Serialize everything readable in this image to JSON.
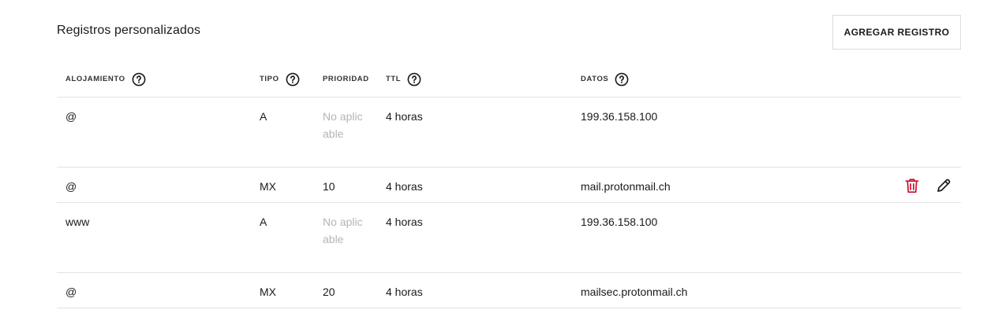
{
  "section": {
    "title": "Registros personalizados",
    "add_button_label": "AGREGAR REGISTRO"
  },
  "table": {
    "columns": {
      "host": "ALOJAMIENTO",
      "type": "TIPO",
      "priority": "PRIORIDAD",
      "ttl": "TTL",
      "data": "DATOS"
    },
    "rows": [
      {
        "host": "@",
        "type": "A",
        "priority": "No aplicable",
        "ttl": "4 horas",
        "data": "199.36.158.100"
      },
      {
        "host": "@",
        "type": "MX",
        "priority": "10",
        "ttl": "4 horas",
        "data": "mail.protonmail.ch"
      },
      {
        "host": "www",
        "type": "A",
        "priority": "No aplicable",
        "ttl": "4 horas",
        "data": "199.36.158.100"
      },
      {
        "host": "@",
        "type": "MX",
        "priority": "20",
        "ttl": "4 horas",
        "data": "mailsec.protonmail.ch"
      }
    ]
  },
  "icons": {
    "help": "question-circle-icon",
    "delete": "trash-icon",
    "edit": "pencil-icon"
  },
  "colors": {
    "delete_icon": "#c8102e",
    "placeholder_text": "#b5b5b5",
    "divider": "#e3e3e3"
  }
}
